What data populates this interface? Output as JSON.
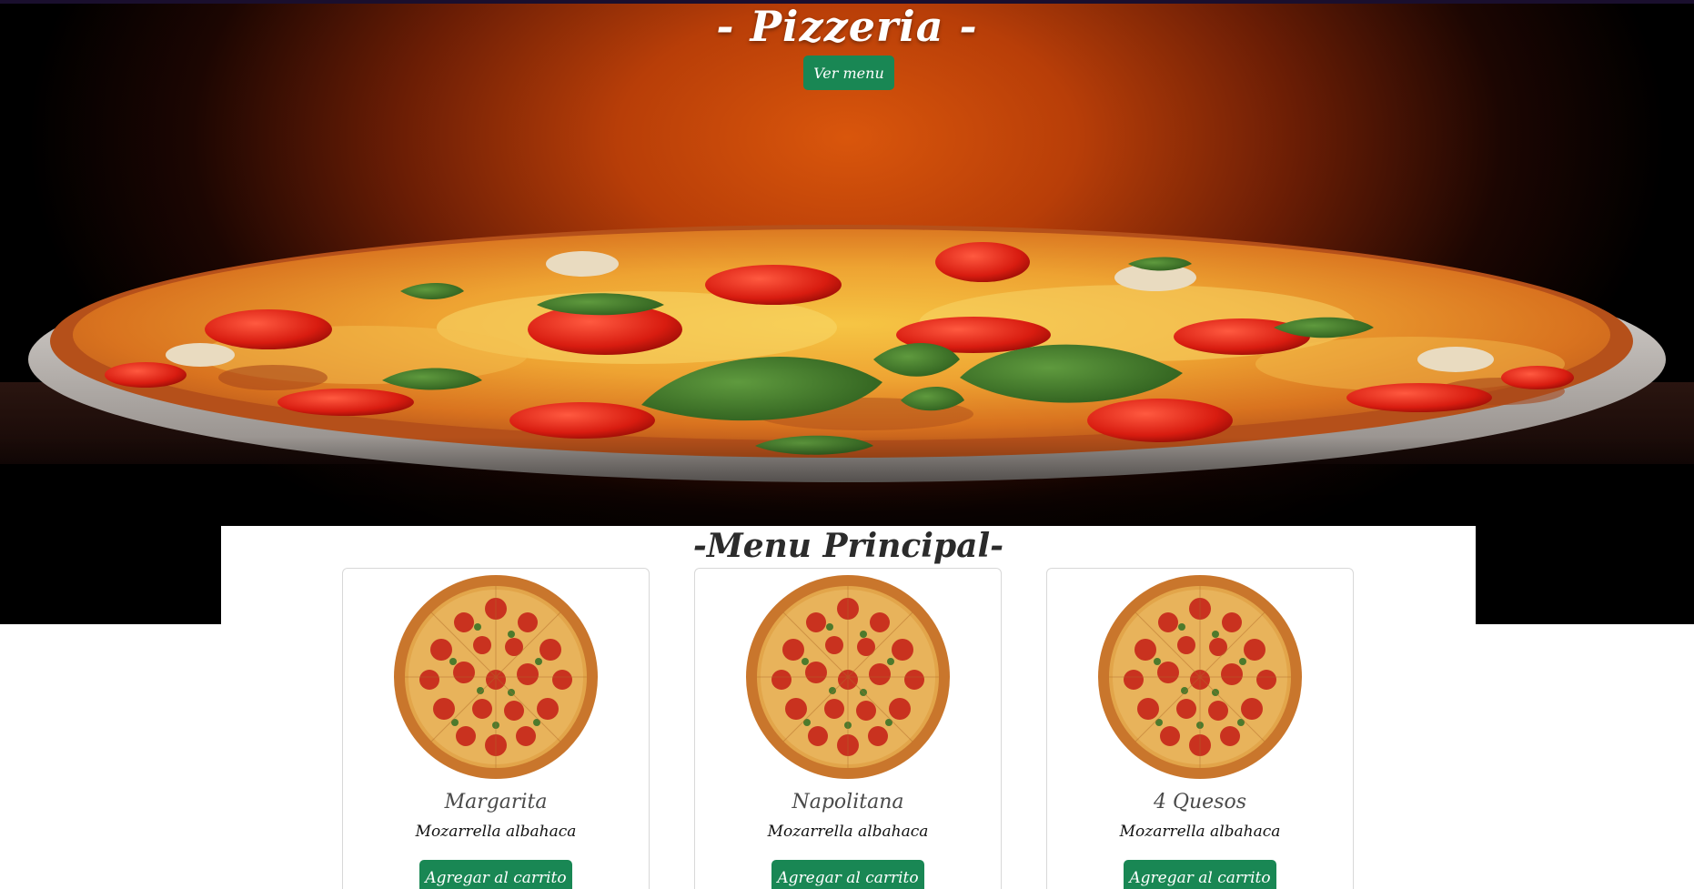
{
  "hero": {
    "title": "- Pizzeria -",
    "button_label": "Ver menu"
  },
  "menu": {
    "title": "-Menu Principal-",
    "items": [
      {
        "name": "Margarita",
        "description": "Mozarrella albahaca",
        "button_label": "Agregar al carrito",
        "image": "pizza-image"
      },
      {
        "name": "Napolitana",
        "description": "Mozarrella albahaca",
        "button_label": "Agregar al carrito",
        "image": "pizza-image"
      },
      {
        "name": "4 Quesos",
        "description": "Mozarrella albahaca",
        "button_label": "Agregar al carrito",
        "image": "pizza-image"
      }
    ]
  },
  "colors": {
    "primary_button": "#198754",
    "hero_glow": "#d9560c",
    "background": "#ffffff"
  }
}
